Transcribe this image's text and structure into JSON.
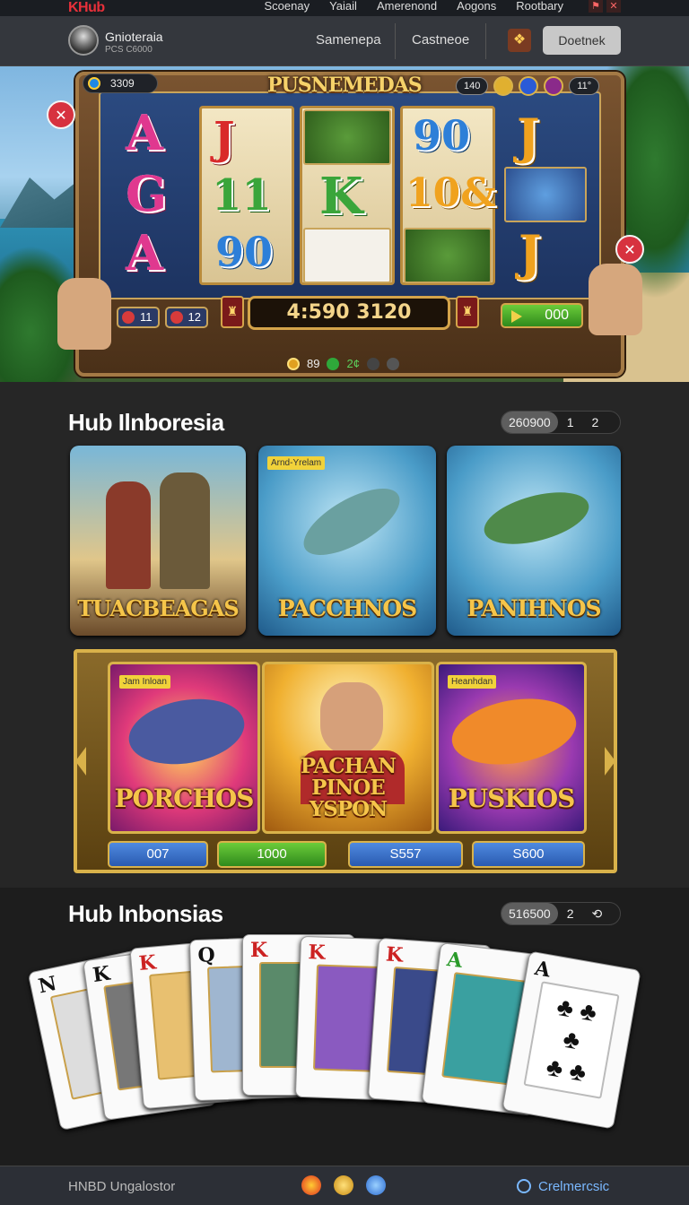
{
  "topbar": {
    "logo": "KHub",
    "nav": [
      "Scoenay",
      "Yaiail",
      "Amerenond",
      "Aogons",
      "Rootbary"
    ]
  },
  "header": {
    "brand_name": "Gnioteraia",
    "brand_sub": "PCS C6000",
    "nav": [
      "Samenepa",
      "Castneoe"
    ],
    "button": "Doetnek"
  },
  "hero": {
    "balance": "3309",
    "title": "PUSNEMEDAS",
    "status_value": "140",
    "status_right": "11°",
    "reels": [
      [
        "A",
        "G",
        "A"
      ],
      [
        "J",
        "11",
        "90"
      ],
      [
        "",
        "K",
        ""
      ],
      [
        "90",
        "10&",
        ""
      ],
      [
        "J",
        "",
        "J"
      ]
    ],
    "win_amount": "4:590 3120",
    "stat_left": [
      "11",
      "12"
    ],
    "spin_label": "000",
    "pager_value": "89",
    "pager_dot": "2¢",
    "colors": {
      "gold": "#d4a44a",
      "red": "#d7323f",
      "green": "#3aa53a"
    }
  },
  "section1": {
    "title": "Hub Ilnboresia",
    "seg_active": "260900",
    "seg_pages": [
      "1",
      "2"
    ],
    "cards": [
      {
        "title": "TUACBEAGAS",
        "tag": ""
      },
      {
        "title": "PACCHNOS",
        "tag": "Arnd-Yrelam"
      },
      {
        "title": "PANIHNOS",
        "tag": ""
      }
    ]
  },
  "promo": {
    "cards": [
      {
        "title": "PORCHOS",
        "tag": "Jam Inloan"
      },
      {
        "title": "PACHAN PINOE YSPON",
        "tag": ""
      },
      {
        "title": "PUSKIOS",
        "tag": "Heanhdan"
      }
    ],
    "buttons": [
      "007",
      "1000",
      "S557",
      "S600"
    ]
  },
  "section2": {
    "title": "Hub Inbonsias",
    "seg_active": "516500",
    "seg_pages": [
      "2"
    ],
    "cards": [
      {
        "rank": "N",
        "suit": "♣"
      },
      {
        "rank": "K",
        "suit": "♣"
      },
      {
        "rank": "K",
        "suit": "♥"
      },
      {
        "rank": "Q",
        "suit": "♠"
      },
      {
        "rank": "K",
        "suit": "♥"
      },
      {
        "rank": "K",
        "suit": "♥"
      },
      {
        "rank": "K",
        "suit": "♥"
      },
      {
        "rank": "A",
        "suit": "♠"
      },
      {
        "rank": "A",
        "suit": "♣"
      }
    ]
  },
  "footer": {
    "left": "HNBD Ungalostor",
    "right": "Crelmercsic"
  }
}
